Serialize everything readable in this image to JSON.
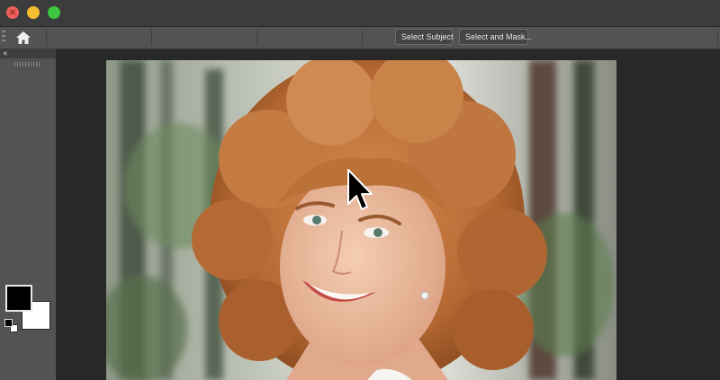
{
  "window": {
    "close_glyph": "×",
    "traffic_lights": {
      "close_color": "#ed5f57",
      "minimize_color": "#f5be31",
      "zoom_color": "#3fc643"
    }
  },
  "options_bar": {
    "home_icon": "home-icon",
    "select_subject_label": "Select Subject",
    "select_and_mask_label": "Select and Mask..."
  },
  "toolbar": {
    "collapse_glyph": "«",
    "foreground_color": "#000000",
    "background_color": "#ffffff"
  },
  "canvas": {
    "image_subject": "curly-haired woman smiling in forest",
    "cursor_icon": "arrow-pointer-icon"
  }
}
